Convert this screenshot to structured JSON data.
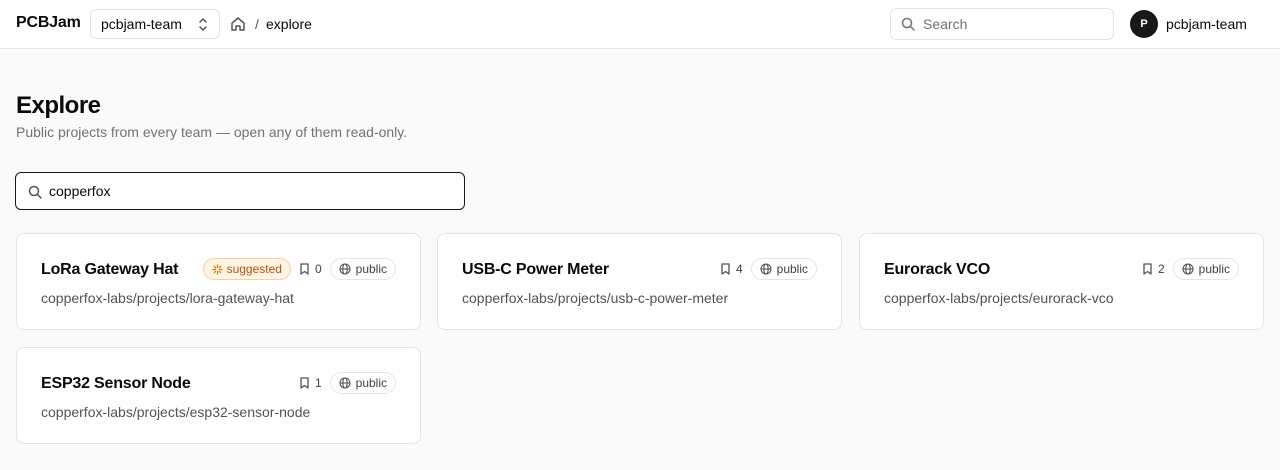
{
  "header": {
    "brand": "PCBJam",
    "team_select": "pcbjam-team",
    "breadcrumb_sep": "/",
    "breadcrumb_current": "explore",
    "search_placeholder": "Search",
    "avatar_initial": "P",
    "user_name": "pcbjam-team"
  },
  "main": {
    "title": "Explore",
    "subtitle": "Public projects from every team — open any of them read-only.",
    "filter_value": "copperfox"
  },
  "projects": [
    {
      "name": "LoRa Gateway Hat",
      "path": "copperfox-labs/projects/lora-gateway-hat",
      "suggested_label": "suggested",
      "stars": "0",
      "visibility": "public"
    },
    {
      "name": "USB-C Power Meter",
      "path": "copperfox-labs/projects/usb-c-power-meter",
      "stars": "4",
      "visibility": "public"
    },
    {
      "name": "Eurorack VCO",
      "path": "copperfox-labs/projects/eurorack-vco",
      "stars": "2",
      "visibility": "public"
    },
    {
      "name": "ESP32 Sensor Node",
      "path": "copperfox-labs/projects/esp32-sensor-node",
      "stars": "1",
      "visibility": "public"
    }
  ],
  "colors": {
    "accent": "#18181b",
    "suggested_bg": "#fff4e5",
    "suggested_text": "#b45309",
    "muted_text": "#71717a"
  },
  "icons": [
    "chevrons-up-down-icon",
    "home-icon",
    "search-icon",
    "sparkle-icon",
    "bookmark-icon",
    "globe-icon"
  ]
}
